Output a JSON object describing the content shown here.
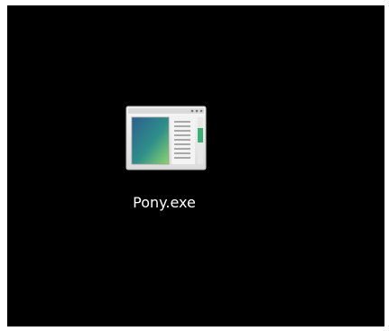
{
  "desktop": {
    "icons": [
      {
        "label": "Pony.exe",
        "icon": "application-window-icon"
      }
    ]
  },
  "colors": {
    "background": "#000000",
    "label": "#ffffff",
    "icon_accent": "#3cae76"
  }
}
